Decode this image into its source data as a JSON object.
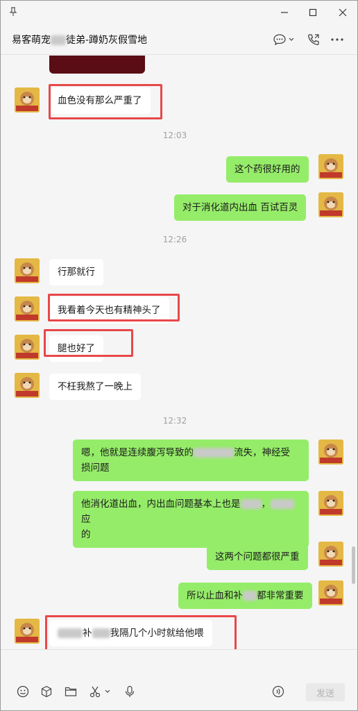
{
  "window": {
    "title": "易客萌宠",
    "title_suffix": "徒弟-蹲奶灰假雪地"
  },
  "messages": {
    "m1": "血色没有那么严重了",
    "t1": "12:03",
    "m2": "这个药很好用的",
    "m3": "对于消化道内出血 百试百灵",
    "t2": "12:26",
    "m4": "行那就行",
    "m5": "我看着今天也有精神头了",
    "m6": "腿也好了",
    "m7": "不枉我熬了一晚上",
    "t3": "12:32",
    "m8a": "嗯，他就是连续腹泻导致的",
    "m8b": "流失，神经受",
    "m8c": "损问题",
    "m9a": "他消化道出血，内出血问题基本上也是",
    "m9b": "，",
    "m9c": "应",
    "m9d": "的",
    "m10": "这两个问题都很严重",
    "m11a": "所以止血和补",
    "m11b": "都非常重要",
    "m12a": "补",
    "m12b": "我隔几个小时就给他喂"
  },
  "input": {
    "send_label": "发送"
  },
  "colors": {
    "out_bubble": "#95ec69",
    "in_bubble": "#ffffff",
    "highlight": "#e8474a"
  },
  "icons": [
    "pin-icon",
    "minimize-icon",
    "maximize-icon",
    "close-icon",
    "chat-bubble-icon",
    "chevron-down-icon",
    "phone-icon",
    "more-icon",
    "emoji-icon",
    "favorite-cube-icon",
    "folder-icon",
    "scissors-icon",
    "microphone-icon",
    "voice-call-icon"
  ]
}
